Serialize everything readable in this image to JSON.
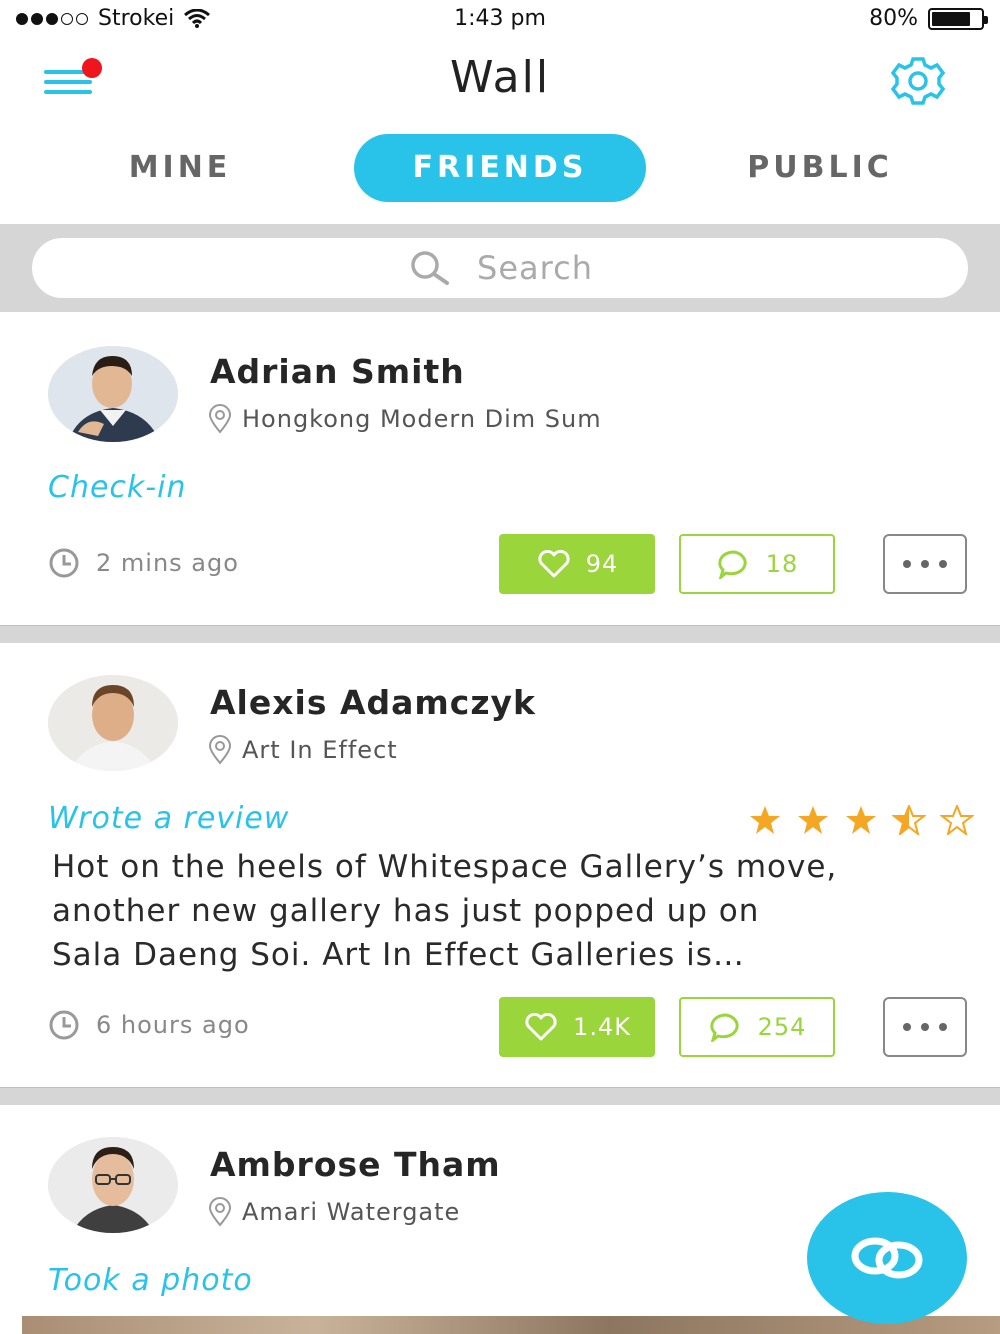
{
  "status_bar": {
    "carrier": "Strokei",
    "time": "1:43 pm",
    "battery": "80%",
    "battery_level": 0.8
  },
  "header": {
    "title": "Wall",
    "menu_icon": "hamburger-icon",
    "settings_icon": "gear-icon"
  },
  "tabs": [
    {
      "label": "MINE",
      "active": false
    },
    {
      "label": "FRIENDS",
      "active": true
    },
    {
      "label": "PUBLIC",
      "active": false
    }
  ],
  "search": {
    "placeholder": "Search"
  },
  "colors": {
    "accent": "#29c3ea",
    "like_green": "#9ad53c",
    "star_orange": "#f5a623",
    "notification_red": "#f0141e"
  },
  "posts": [
    {
      "name": "Adrian Smith",
      "place": "Hongkong Modern Dim Sum",
      "activity": "Check-in",
      "time": "2 mins ago",
      "likes": "94",
      "comments": "18"
    },
    {
      "name": "Alexis Adamczyk",
      "place": "Art In Effect",
      "activity": "Wrote a review",
      "rating": 3.5,
      "rating_max": 5,
      "review_lines": [
        "Hot on the heels of Whitespace Gallery’s move,",
        "another new gallery has just popped up on",
        "Sala Daeng Soi. Art In Effect Galleries is…"
      ],
      "time": "6 hours ago",
      "likes": "1.4K",
      "comments": "254"
    },
    {
      "name": "Ambrose Tham",
      "place": "Amari Watergate",
      "activity": "Took a photo"
    }
  ],
  "fab": {
    "icon": "linked-rings-icon"
  }
}
